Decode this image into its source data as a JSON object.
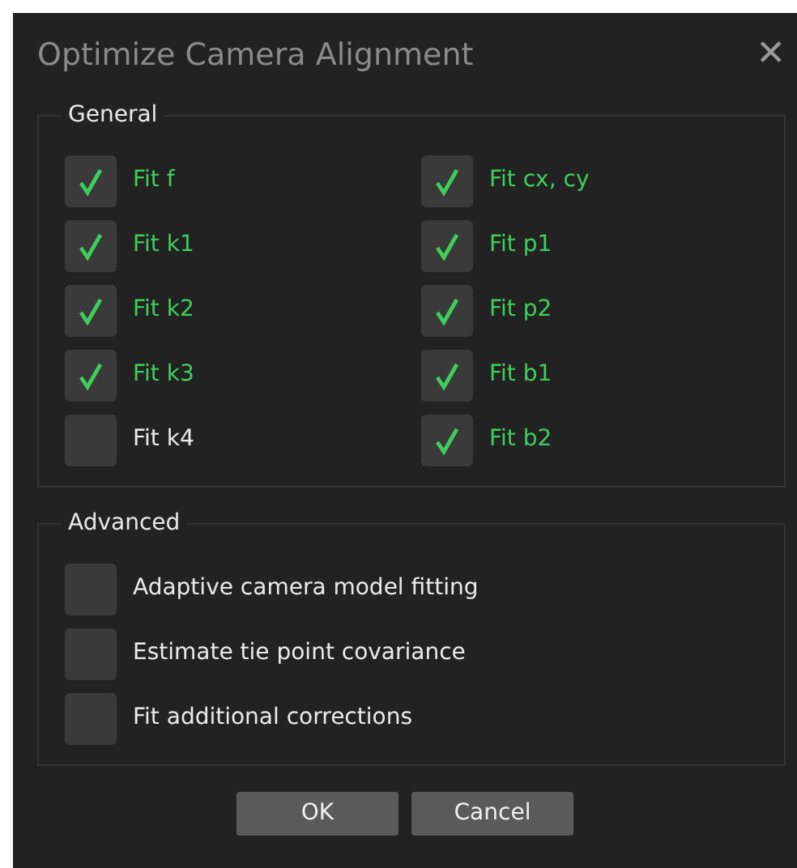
{
  "window": {
    "title": "Optimize Camera Alignment",
    "close": "✕"
  },
  "groups": [
    {
      "title": "General",
      "kind": "grid",
      "items": [
        {
          "label": "Fit f",
          "checked": true
        },
        {
          "label": "Fit cx, cy",
          "checked": true
        },
        {
          "label": "Fit k1",
          "checked": true
        },
        {
          "label": "Fit p1",
          "checked": true
        },
        {
          "label": "Fit k2",
          "checked": true
        },
        {
          "label": "Fit p2",
          "checked": true
        },
        {
          "label": "Fit k3",
          "checked": true
        },
        {
          "label": "Fit b1",
          "checked": true
        },
        {
          "label": "Fit k4",
          "checked": false
        },
        {
          "label": "Fit b2",
          "checked": true
        }
      ]
    },
    {
      "title": "Advanced",
      "kind": "list",
      "items": [
        {
          "label": "Adaptive camera model fitting",
          "checked": false
        },
        {
          "label": "Estimate tie point covariance",
          "checked": false
        },
        {
          "label": "Fit additional corrections",
          "checked": false
        }
      ]
    }
  ],
  "buttons": [
    "OK",
    "Cancel"
  ]
}
